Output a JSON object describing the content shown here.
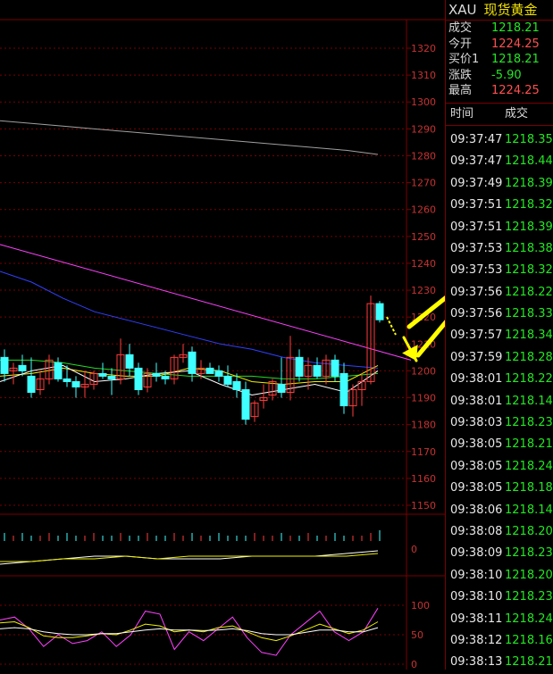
{
  "colors": {
    "background": "#000000",
    "grid": "#7a0000",
    "axis_label": "#c83232",
    "candle_up": "#ff3c3c",
    "candle_down": "#40ffff",
    "ma_short": "#ffffff",
    "ma_mid": "#f0f000",
    "ma_long": "#22dd22",
    "ma_blue": "#3040ff",
    "ma_gray": "#a0a0a0",
    "trendline": "#ff40ff",
    "arrow": "#ffff00",
    "price_up": "#ff5050",
    "price_down": "#22e822"
  },
  "panel": {
    "code": "XAU",
    "name": "现货黄金",
    "quotes": [
      {
        "label": "成交",
        "value": "1218.21",
        "color": "down"
      },
      {
        "label": "今开",
        "value": "1224.25",
        "color": "up"
      },
      {
        "label": "买价1",
        "value": "1218.21",
        "color": "down"
      },
      {
        "label": "涨跌",
        "value": "-5.90",
        "color": "down"
      },
      {
        "label": "最高",
        "value": "1224.25",
        "color": "up"
      }
    ],
    "ticks_header": {
      "time": "时间",
      "price": "成交"
    },
    "ticks": [
      {
        "time": "09:37:47",
        "price": "1218.35"
      },
      {
        "time": "09:37:47",
        "price": "1218.44"
      },
      {
        "time": "09:37:49",
        "price": "1218.39"
      },
      {
        "time": "09:37:51",
        "price": "1218.32"
      },
      {
        "time": "09:37:51",
        "price": "1218.39"
      },
      {
        "time": "09:37:53",
        "price": "1218.38"
      },
      {
        "time": "09:37:53",
        "price": "1218.32"
      },
      {
        "time": "09:37:56",
        "price": "1218.22"
      },
      {
        "time": "09:37:56",
        "price": "1218.33"
      },
      {
        "time": "09:37:57",
        "price": "1218.34"
      },
      {
        "time": "09:37:59",
        "price": "1218.28"
      },
      {
        "time": "09:38:01",
        "price": "1218.22"
      },
      {
        "time": "09:38:01",
        "price": "1218.14"
      },
      {
        "time": "09:38:03",
        "price": "1218.23"
      },
      {
        "time": "09:38:05",
        "price": "1218.21"
      },
      {
        "time": "09:38:05",
        "price": "1218.24"
      },
      {
        "time": "09:38:05",
        "price": "1218.18"
      },
      {
        "time": "09:38:06",
        "price": "1218.14"
      },
      {
        "time": "09:38:08",
        "price": "1218.20"
      },
      {
        "time": "09:38:09",
        "price": "1218.23"
      },
      {
        "time": "09:38:10",
        "price": "1218.20"
      },
      {
        "time": "09:38:10",
        "price": "1218.23"
      },
      {
        "time": "09:38:11",
        "price": "1218.24"
      },
      {
        "time": "09:38:12",
        "price": "1218.16"
      },
      {
        "time": "09:38:13",
        "price": "1218.21"
      }
    ]
  },
  "chart_data": [
    {
      "type": "candlestick",
      "y_ticks": [
        "1320",
        "1310",
        "1300",
        "1290",
        "1280",
        "1270",
        "1260",
        "1250",
        "1240",
        "1230",
        "1220",
        "1210",
        "1200",
        "1190",
        "1180",
        "1170",
        "1160",
        "1150"
      ],
      "ylim": [
        1147,
        1325
      ],
      "candles": [
        {
          "o": 1205,
          "h": 1208,
          "l": 1196,
          "c": 1199
        },
        {
          "o": 1200,
          "h": 1203,
          "l": 1195,
          "c": 1201
        },
        {
          "o": 1202,
          "h": 1206,
          "l": 1198,
          "c": 1200
        },
        {
          "o": 1198,
          "h": 1205,
          "l": 1190,
          "c": 1192
        },
        {
          "o": 1193,
          "h": 1200,
          "l": 1191,
          "c": 1197
        },
        {
          "o": 1197,
          "h": 1206,
          "l": 1195,
          "c": 1204
        },
        {
          "o": 1203,
          "h": 1205,
          "l": 1196,
          "c": 1197
        },
        {
          "o": 1197,
          "h": 1202,
          "l": 1194,
          "c": 1196
        },
        {
          "o": 1196,
          "h": 1198,
          "l": 1190,
          "c": 1194
        },
        {
          "o": 1194,
          "h": 1200,
          "l": 1190,
          "c": 1195
        },
        {
          "o": 1195,
          "h": 1200,
          "l": 1193,
          "c": 1199
        },
        {
          "o": 1199,
          "h": 1203,
          "l": 1197,
          "c": 1198
        },
        {
          "o": 1198,
          "h": 1201,
          "l": 1191,
          "c": 1197
        },
        {
          "o": 1197,
          "h": 1212,
          "l": 1195,
          "c": 1206
        },
        {
          "o": 1206,
          "h": 1210,
          "l": 1198,
          "c": 1201
        },
        {
          "o": 1201,
          "h": 1203,
          "l": 1191,
          "c": 1193
        },
        {
          "o": 1194,
          "h": 1201,
          "l": 1192,
          "c": 1199
        },
        {
          "o": 1199,
          "h": 1203,
          "l": 1196,
          "c": 1198
        },
        {
          "o": 1198,
          "h": 1200,
          "l": 1195,
          "c": 1197
        },
        {
          "o": 1197,
          "h": 1206,
          "l": 1195,
          "c": 1205
        },
        {
          "o": 1205,
          "h": 1210,
          "l": 1203,
          "c": 1206
        },
        {
          "o": 1207,
          "h": 1209,
          "l": 1196,
          "c": 1199
        },
        {
          "o": 1199,
          "h": 1204,
          "l": 1197,
          "c": 1201
        },
        {
          "o": 1201,
          "h": 1203,
          "l": 1199,
          "c": 1199
        },
        {
          "o": 1200,
          "h": 1202,
          "l": 1196,
          "c": 1198
        },
        {
          "o": 1198,
          "h": 1202,
          "l": 1194,
          "c": 1195
        },
        {
          "o": 1196,
          "h": 1199,
          "l": 1190,
          "c": 1193
        },
        {
          "o": 1193,
          "h": 1196,
          "l": 1180,
          "c": 1182
        },
        {
          "o": 1183,
          "h": 1189,
          "l": 1181,
          "c": 1188
        },
        {
          "o": 1189,
          "h": 1195,
          "l": 1186,
          "c": 1190
        },
        {
          "o": 1191,
          "h": 1197,
          "l": 1189,
          "c": 1196
        },
        {
          "o": 1195,
          "h": 1205,
          "l": 1190,
          "c": 1192
        },
        {
          "o": 1192,
          "h": 1213,
          "l": 1189,
          "c": 1205
        },
        {
          "o": 1205,
          "h": 1208,
          "l": 1196,
          "c": 1198
        },
        {
          "o": 1198,
          "h": 1205,
          "l": 1193,
          "c": 1202
        },
        {
          "o": 1202,
          "h": 1205,
          "l": 1197,
          "c": 1198
        },
        {
          "o": 1198,
          "h": 1206,
          "l": 1195,
          "c": 1204
        },
        {
          "o": 1204,
          "h": 1206,
          "l": 1196,
          "c": 1198
        },
        {
          "o": 1199,
          "h": 1203,
          "l": 1184,
          "c": 1187
        },
        {
          "o": 1187,
          "h": 1195,
          "l": 1183,
          "c": 1193
        },
        {
          "o": 1193,
          "h": 1199,
          "l": 1187,
          "c": 1196
        },
        {
          "o": 1196,
          "h": 1228,
          "l": 1195,
          "c": 1225
        },
        {
          "o": 1225,
          "h": 1226,
          "l": 1218,
          "c": 1219
        }
      ],
      "ma_lines": {
        "gray": [
          1293,
          1292,
          1291,
          1290,
          1289,
          1288,
          1287,
          1286,
          1285,
          1284,
          1283,
          1282,
          1280.5
        ],
        "magenta_start": 1247,
        "magenta_end": 1204,
        "blue": [
          1237,
          1233,
          1227,
          1222,
          1219,
          1216,
          1213,
          1210,
          1208,
          1205,
          1203,
          1202,
          1201
        ],
        "green": [
          1204,
          1204,
          1203,
          1201,
          1200,
          1199,
          1198,
          1198,
          1198,
          1197,
          1197,
          1198,
          1199
        ],
        "yellow": [
          1198,
          1199,
          1201,
          1199,
          1198,
          1198,
          1201,
          1200,
          1196,
          1195,
          1196,
          1196,
          1202
        ],
        "white": [
          1196,
          1200,
          1202,
          1196,
          1197,
          1199,
          1200,
          1195,
          1191,
          1193,
          1195,
          1192,
          1200
        ]
      }
    },
    {
      "type": "volume",
      "y_ticks": [
        "0"
      ],
      "bars": [
        3,
        2,
        3,
        2,
        2,
        3,
        2,
        3,
        2,
        2,
        3,
        2,
        2,
        3,
        2,
        2,
        3,
        2,
        2,
        3,
        2,
        3,
        2,
        2,
        3,
        2,
        2,
        2,
        3,
        2,
        2,
        3,
        2,
        2,
        3,
        2,
        2,
        3,
        2,
        2,
        2,
        3,
        4
      ],
      "lines": {
        "white": [
          -2,
          -1,
          0,
          1,
          1,
          0,
          0,
          0,
          1,
          1,
          1,
          2,
          3
        ],
        "yellow": [
          -1,
          -1,
          0,
          0,
          1,
          0,
          1,
          1,
          1,
          1,
          1,
          1,
          2
        ]
      }
    },
    {
      "type": "oscillator",
      "y_ticks": [
        "100",
        "50",
        "0"
      ],
      "ylim": [
        0,
        100
      ],
      "series": {
        "magenta": [
          75,
          80,
          60,
          30,
          50,
          35,
          40,
          55,
          30,
          50,
          90,
          85,
          25,
          55,
          40,
          60,
          80,
          45,
          20,
          15,
          50,
          70,
          90,
          55,
          40,
          55,
          95
        ],
        "yellow": [
          70,
          72,
          62,
          48,
          45,
          45,
          48,
          52,
          50,
          58,
          68,
          65,
          55,
          58,
          55,
          62,
          65,
          55,
          45,
          40,
          48,
          58,
          68,
          60,
          52,
          58,
          72
        ],
        "white": [
          60,
          62,
          60,
          55,
          52,
          50,
          50,
          52,
          52,
          55,
          58,
          60,
          58,
          58,
          57,
          58,
          60,
          57,
          52,
          50,
          50,
          54,
          58,
          58,
          55,
          55,
          62
        ]
      }
    }
  ]
}
